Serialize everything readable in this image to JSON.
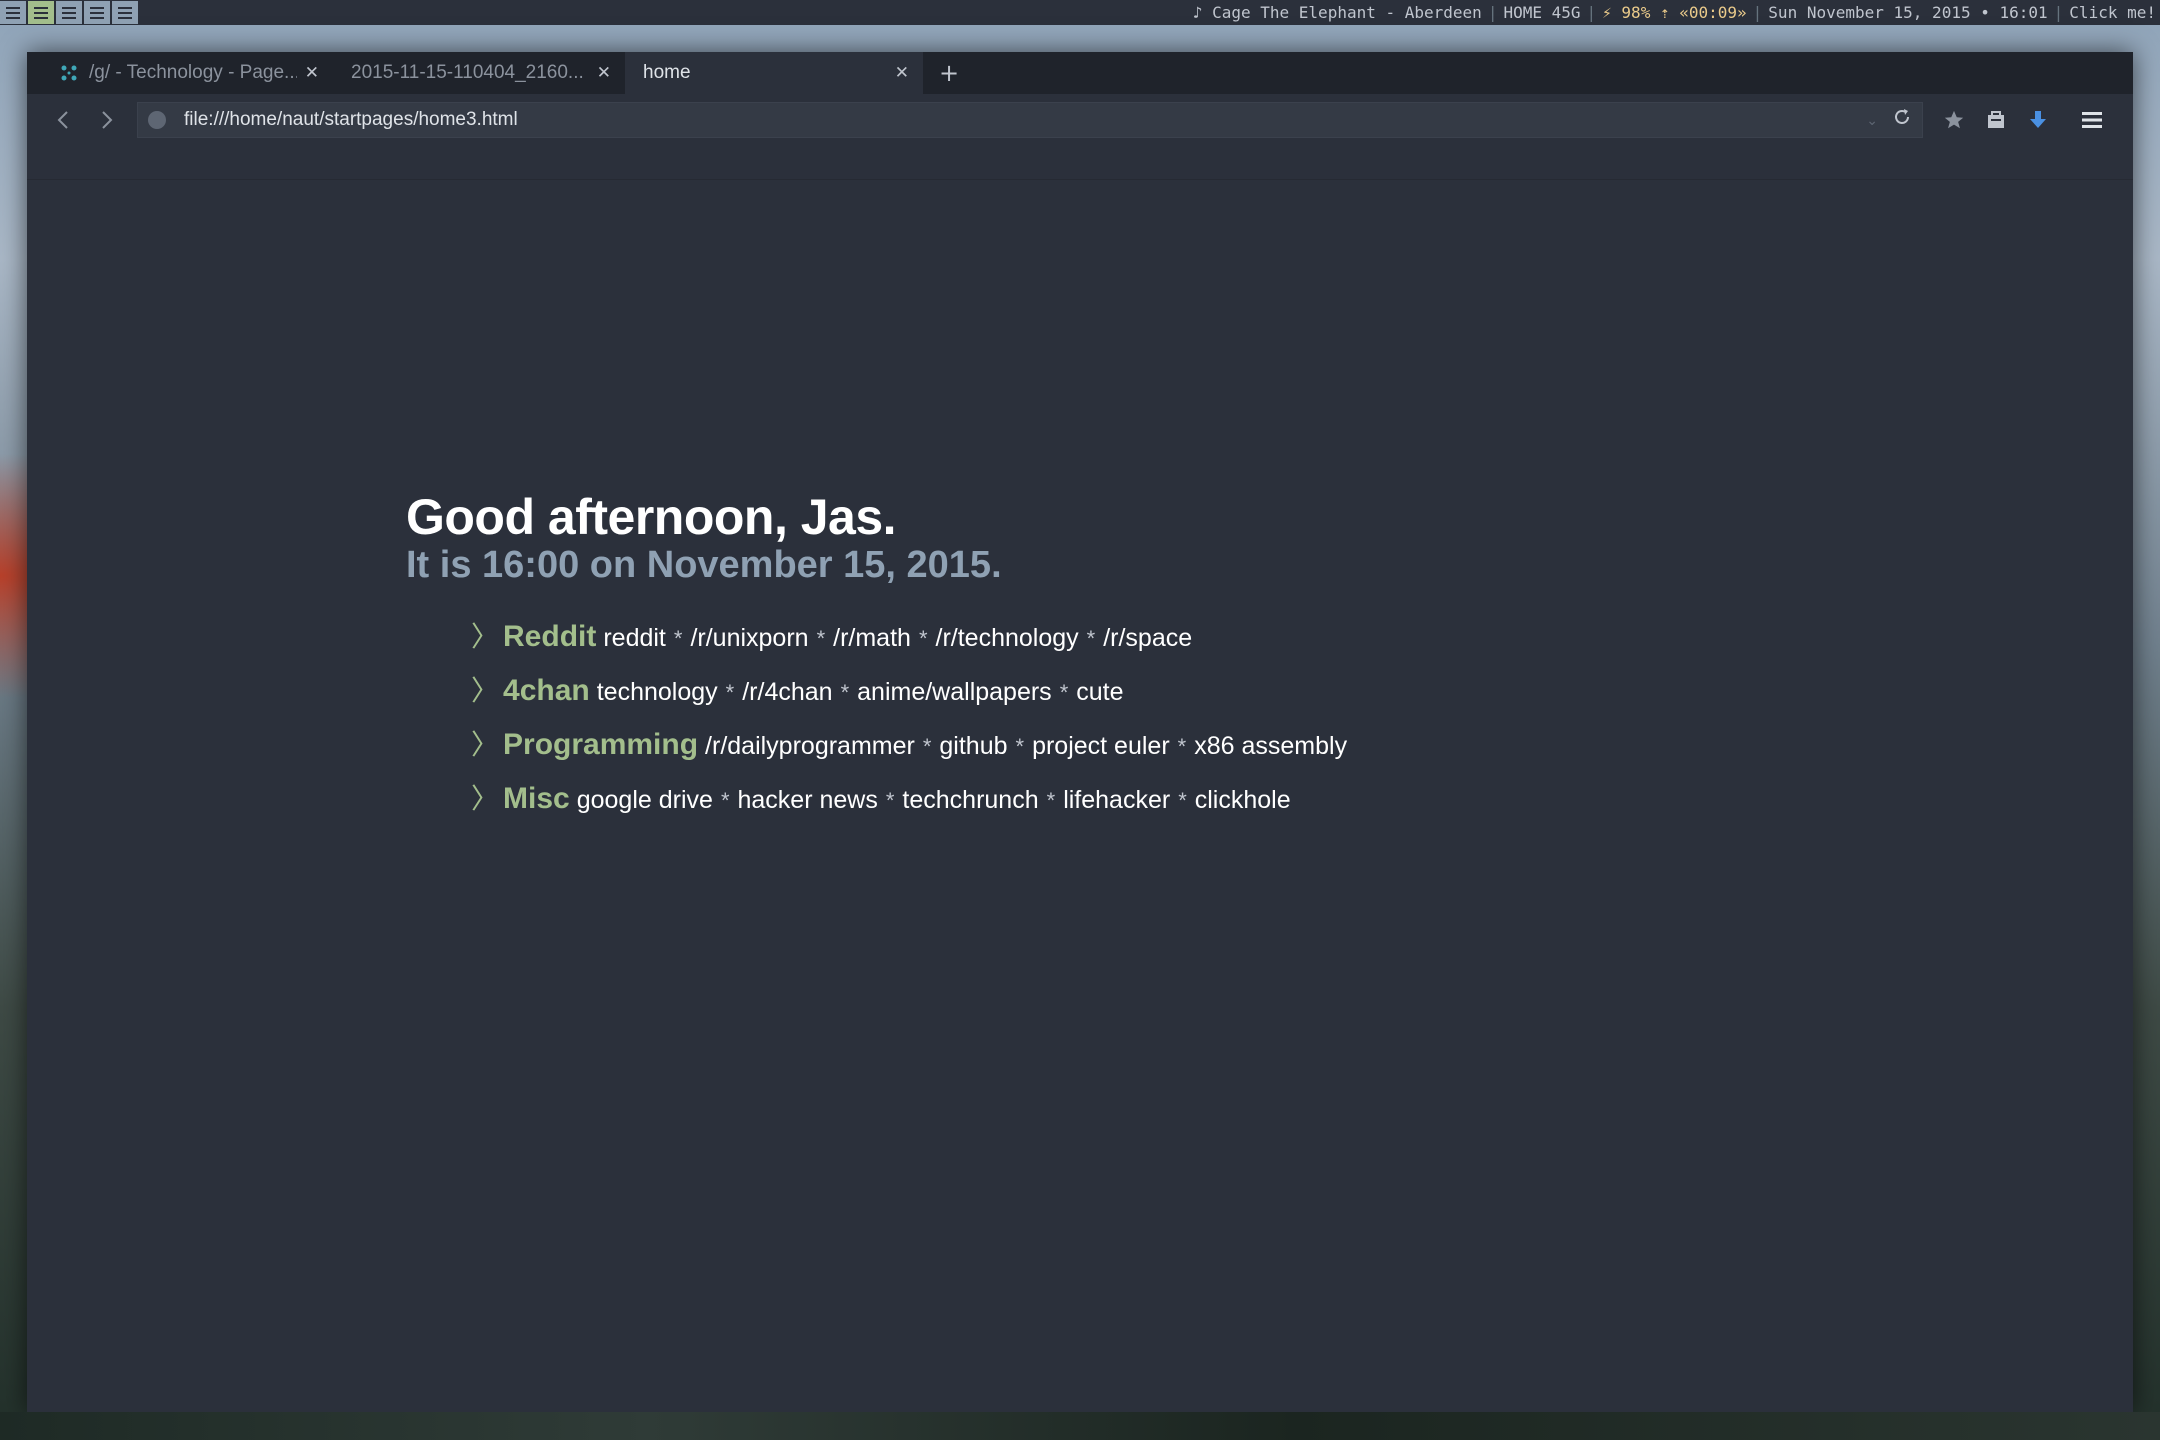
{
  "topbar": {
    "workspaces": [
      {
        "id": 1,
        "active": false
      },
      {
        "id": 2,
        "active": true
      },
      {
        "id": 3,
        "active": false
      },
      {
        "id": 4,
        "active": false
      },
      {
        "id": 5,
        "active": false
      }
    ],
    "now_playing": "♪ Cage The Elephant - Aberdeen",
    "disk": "HOME 45G",
    "battery": "⚡ 98% ⇡ «00:09»",
    "datetime": "Sun November 15, 2015 • 16:01",
    "click_label": "Click me!"
  },
  "tabs": [
    {
      "label": "/g/ - Technology - Page...",
      "active": false
    },
    {
      "label": "2015-11-15-110404_2160...",
      "active": false
    },
    {
      "label": "home",
      "active": true
    }
  ],
  "newtab_label": "+",
  "url": "file:///home/naut/startpages/home3.html",
  "page": {
    "greeting": "Good afternoon, Jas.",
    "datetime": "It is 16:00 on November 15, 2015.",
    "chevron": "〉",
    "separator": "*",
    "categories": [
      {
        "name": "Reddit",
        "links": [
          "reddit",
          "/r/unixporn",
          "/r/math",
          "/r/technology",
          "/r/space"
        ]
      },
      {
        "name": "4chan",
        "links": [
          "technology",
          "/r/4chan",
          "anime/wallpapers",
          "cute"
        ]
      },
      {
        "name": "Programming",
        "links": [
          "/r/dailyprogrammer",
          "github",
          "project euler",
          "x86 assembly"
        ]
      },
      {
        "name": "Misc",
        "links": [
          "google drive",
          "hacker news",
          "techchrunch",
          "lifehacker",
          "clickhole"
        ]
      }
    ]
  },
  "colors": {
    "background": "#2b303b",
    "accent_green": "#a3be8c",
    "subtitle_blue": "#8fa1b3",
    "download_blue": "#4a90e2"
  }
}
